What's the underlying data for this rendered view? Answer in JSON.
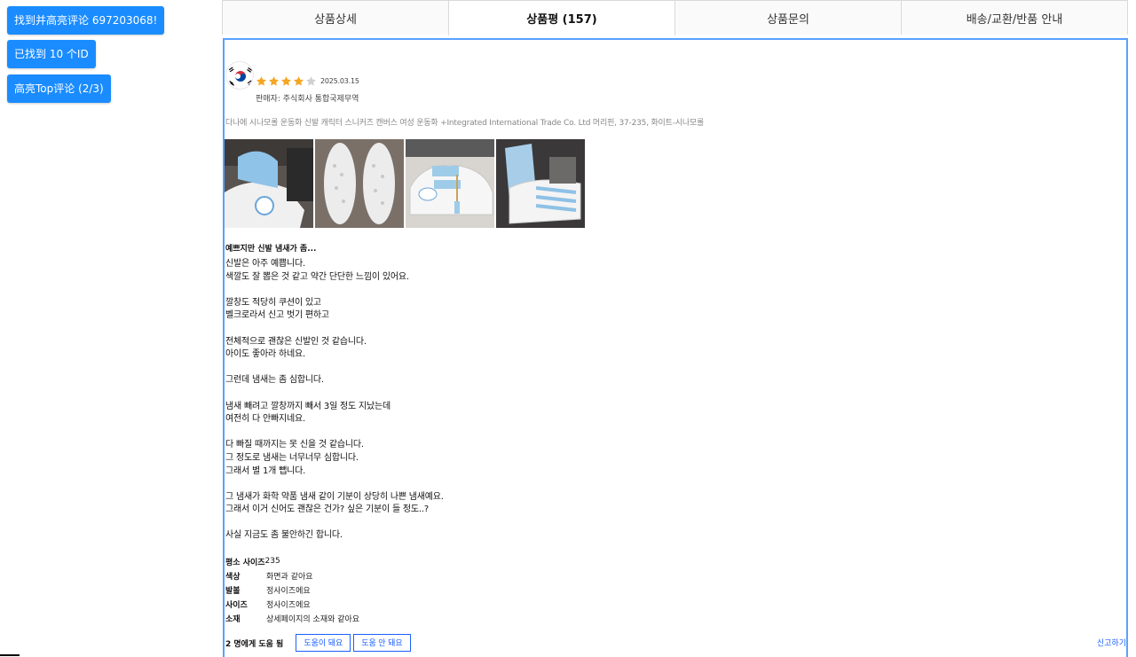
{
  "side_buttons": {
    "find_highlight": "找到并高亮评论 697203068!",
    "found_ids": "已找到 10 个ID",
    "highlight_top": "高亮Top评论 (2/3)"
  },
  "tabs": [
    {
      "label": "상품상세"
    },
    {
      "label": "상품평 (157)"
    },
    {
      "label": "상품문의"
    },
    {
      "label": "배송/교환/반품 안내"
    }
  ],
  "review": {
    "rating": 4,
    "rating_max": 5,
    "date": "2025.03.15",
    "seller": "판매자: 주식회사 통합국제무역",
    "option": "다나에 시나모롤 운동화 신발 캐릭터 스니커즈 캔버스 여성 운동화 +Integrated International Trade Co. Ltd 머리핀, 37-235, 화이트-시나모롤",
    "headline": "예쁘지만 신발 냄새가 좀...",
    "body": "신발은 아주 예쁩니다.\n색깔도 잘 뽑은 것 같고 약간 단단한 느낌이 있어요.\n\n깔창도 적당히 쿠션이 있고\n벨크로라서 신고 벗기 편하고\n\n전체적으로 괜찮은 신발인 것 같습니다.\n아이도 좋아라 하네요.\n\n그런데 냄새는 좀 심합니다.\n\n냄새 빼려고 깔창까지 빼서 3일 정도 지났는데\n여전히 다 안빠지네요.\n\n다 빠질 때까지는 못 신을 것 같습니다.\n그 정도로 냄새는 너무너무 심합니다.\n그래서 별 1개 뺍니다.\n\n그 냄새가 화학 약품 냄새 같이 기분이 상당히 나쁜 냄새예요.\n그래서 이거 신어도 괜찮은 건가? 싶은 기분이 들 정도..?\n\n사실 지금도 좀 불안하긴 합니다.",
    "size_label": "평소 사이즈",
    "size_value": "235",
    "attributes": [
      {
        "key": "색상",
        "value": "화면과 같아요"
      },
      {
        "key": "발볼",
        "value": "정사이즈에요"
      },
      {
        "key": "사이즈",
        "value": "정사이즈에요"
      },
      {
        "key": "소재",
        "value": "상세페이지의 소재와 같아요"
      }
    ],
    "helpful_count": "2 명에게 도움 됨",
    "helpful_yes": "도움이 돼요",
    "helpful_no": "도움 안 돼요",
    "report": "신고하기"
  },
  "colors": {
    "accent_blue": "#1a8cff",
    "star": "#f5a623",
    "star_empty": "#d0d0d0",
    "link_blue": "#1a5fff",
    "panel_border": "#5aa0ff"
  },
  "icons": {
    "flag": "korea-flag-icon",
    "star": "star-icon"
  }
}
